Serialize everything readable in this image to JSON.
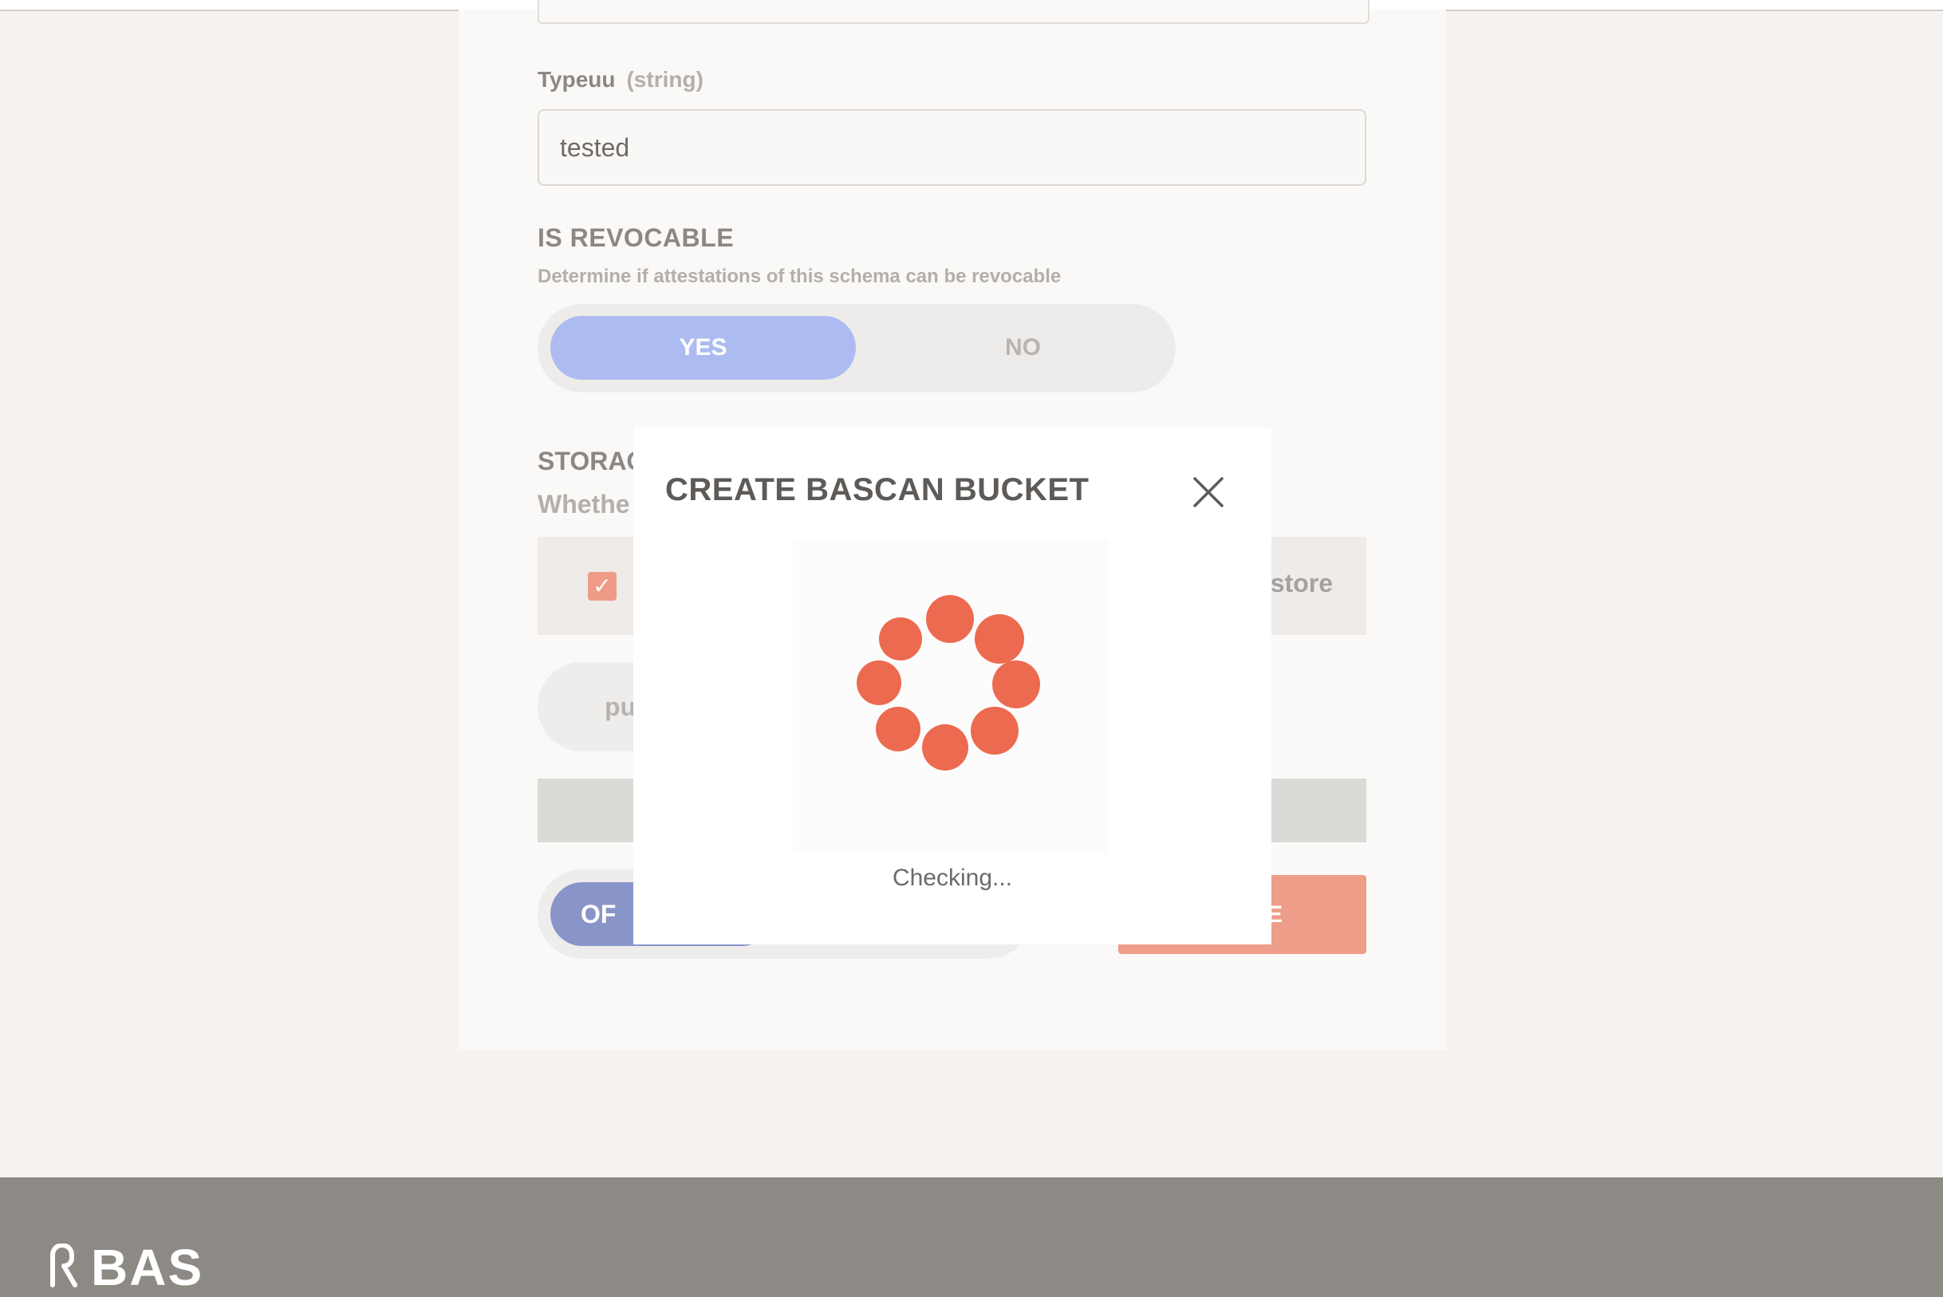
{
  "form": {
    "field_label": "Typeuu",
    "field_type": "(string)",
    "field_value": "tested",
    "revocable": {
      "title": "IS REVOCABLE",
      "description": "Determine if attestations of this schema can be revocable",
      "yes_label": "YES",
      "no_label": "NO",
      "selected": "YES"
    },
    "storage": {
      "title_partial": "STORAG",
      "desc_partial": "Whethe",
      "option_partial": "store",
      "checked": true,
      "pill_partial": "pu"
    },
    "bottom_toggle_partial": "OF",
    "create_partial": "E"
  },
  "modal": {
    "title": "CREATE BASCAN BUCKET",
    "status": "Checking...",
    "spinner_color": "#ec6a4f"
  },
  "footer": {
    "logo_text": "BAS"
  }
}
